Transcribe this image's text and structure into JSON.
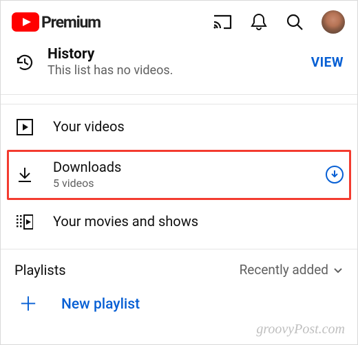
{
  "brand": {
    "name": "Premium"
  },
  "history": {
    "title": "History",
    "subtitle": "This list has no videos.",
    "view_label": "VIEW"
  },
  "items": {
    "your_videos": {
      "label": "Your videos"
    },
    "downloads": {
      "label": "Downloads",
      "subtitle": "5 videos"
    },
    "movies_shows": {
      "label": "Your movies and shows"
    }
  },
  "playlists": {
    "heading": "Playlists",
    "sort_label": "Recently added",
    "new_label": "New playlist"
  },
  "watermark": "groovyPost.com"
}
